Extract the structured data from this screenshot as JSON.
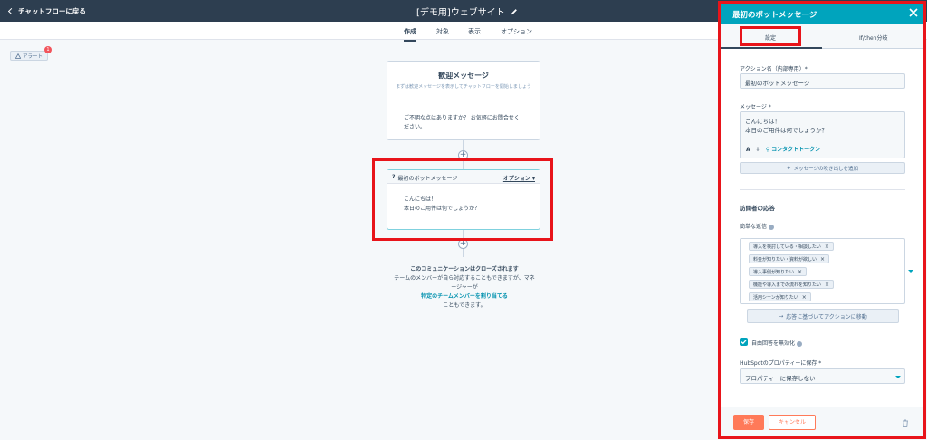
{
  "topbar": {
    "back_label": "チャットフローに戻る",
    "page_title": "[デモ用]ウェブサイト"
  },
  "tabs": [
    "作成",
    "対象",
    "表示",
    "オプション"
  ],
  "alert": {
    "label": "アラート",
    "count": "1"
  },
  "welcome_card": {
    "title": "歓迎メッセージ",
    "subtitle": "まずは歓迎メッセージを表示してチャットフローを開始しましょう",
    "message_line1": "ご不明な点はありますか？ お気軽にお問合せく",
    "message_line2": "ださい。"
  },
  "bot_card": {
    "title": "最初のボットメッセージ",
    "options_label": "オプション",
    "message_line1": "こんにちは！",
    "message_line2": "本日のご用件は何でしょうか？"
  },
  "closed_note": {
    "title": "このコミュニケーションはクローズされます",
    "line1": "チームのメンバーが自ら対応することもできますが、マネ",
    "line2": "ージャーが",
    "link": "特定のチームメンバーを割り当てる",
    "line3": "こともできます。"
  },
  "panel": {
    "title": "最初のボットメッセージ",
    "tabs": [
      "設定",
      "If/then分岐"
    ],
    "action_name_label": "アクション名（内部専用）*",
    "action_name_value": "最初のボットメッセージ",
    "message_label": "メッセージ *",
    "message_line1": "こんにちは！",
    "message_line2": "本日のご用件は何でしょうか？",
    "contact_token": "コンタクトトークン",
    "add_reply_button": "メッセージの吹き出しを追加",
    "visitor_response_title": "訪問者の応答",
    "quick_replies_label": "簡単な返信",
    "quick_replies": [
      "導入を検討している・相談したい",
      "料金が知りたい・資料が欲しい",
      "導入事例が知りたい",
      "機能や導入までの流れを知りたい",
      "活用シーンが知りたい"
    ],
    "action_by_reply_button": "応答に基づいてアクションに移動",
    "disable_free_text_label": "自由回答を無効化",
    "save_property_label": "HubSpotのプロパティーに保存 *",
    "save_property_value": "プロパティーに保存しない",
    "save_button": "保存",
    "cancel_button": "キャンセル"
  },
  "colors": {
    "topbar": "#2d3e50",
    "accent": "#00a4bd",
    "highlight": "#e8141a",
    "primary_button": "#ff7a59"
  }
}
